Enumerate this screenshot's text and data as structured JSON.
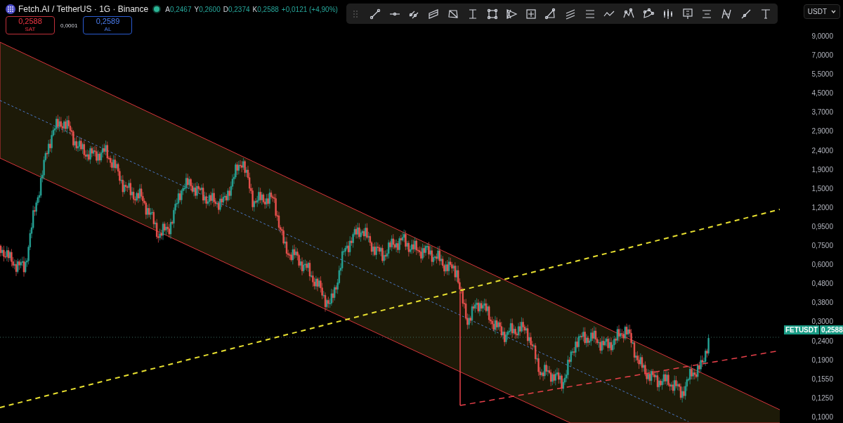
{
  "header": {
    "symbol": "Fetch.AI / TetherUS · 1G · Binance",
    "ohlc": [
      {
        "letter": "A",
        "value": "0,2467"
      },
      {
        "letter": "Y",
        "value": "0,2600"
      },
      {
        "letter": "D",
        "value": "0,2374"
      },
      {
        "letter": "K",
        "value": "0,2588"
      }
    ],
    "change": "+0,0121 (+4,90%)"
  },
  "trade": {
    "sell": {
      "price": "0,2588",
      "label": "SAT"
    },
    "spread": "0,0001",
    "buy": {
      "price": "0,2589",
      "label": "AL"
    }
  },
  "currency": "USDT",
  "price_axis": {
    "ticks": [
      "9,0000",
      "7,0000",
      "5,5000",
      "4,5000",
      "3,7000",
      "2,9000",
      "2,4000",
      "1,9000",
      "1,5000",
      "1,2000",
      "0,9500",
      "0,7500",
      "0,6000",
      "0,4800",
      "0,3800",
      "0,3000",
      "0,2400",
      "0,1900",
      "0,1550",
      "0,1250",
      "0,1000"
    ]
  },
  "last_price": {
    "symbol": "FETUSDT",
    "price": "0,2588"
  }
}
